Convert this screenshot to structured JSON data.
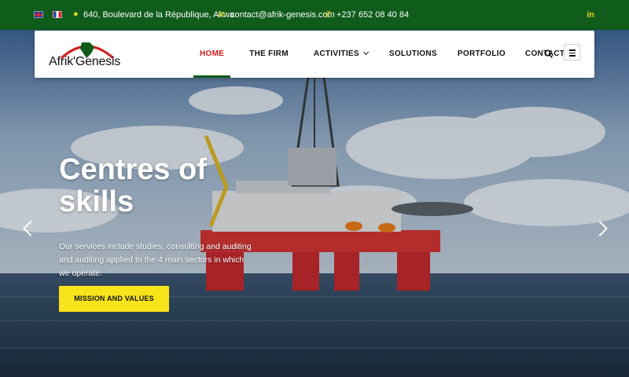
{
  "topbar": {
    "languages": [
      "English",
      "Français"
    ],
    "address": "640, Boulevard de la République, Akwa",
    "email": "contact@afrik-genesis.com",
    "phone": "+237 652 08 40 84",
    "social": "in"
  },
  "brand": {
    "logo_text": "Afrik'Genesis",
    "colors": {
      "primary_green": "#0f5c1b",
      "accent_red": "#d11c1c",
      "accent_yellow": "#f7e41a"
    }
  },
  "nav": {
    "items": [
      {
        "label": "HOME",
        "active": true
      },
      {
        "label": "THE FIRM"
      },
      {
        "label": "ACTIVITIES",
        "dropdown": true
      },
      {
        "label": "SOLUTIONS"
      },
      {
        "label": "PORTFOLIO"
      },
      {
        "label": "CONTACT"
      }
    ],
    "search_icon": "search-icon",
    "menu_icon": "hamburger-icon"
  },
  "hero": {
    "title": "Centres of skills",
    "description": "Our services include studies, consulting and auditing and auditing applied to the 4 main sectors in which we operate.",
    "cta_label": "MISSION AND VALUES",
    "prev_icon": "chevron-left-icon",
    "next_icon": "chevron-right-icon"
  }
}
